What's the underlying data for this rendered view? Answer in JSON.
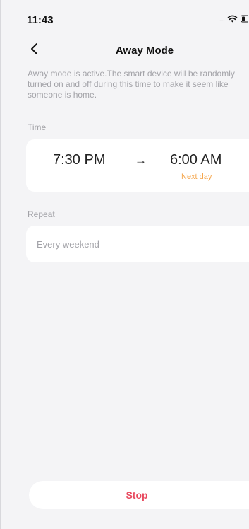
{
  "status_bar": {
    "time": "11:43",
    "signal_dots": "....",
    "wifi_icon": "wifi-icon",
    "battery_icon": "battery-icon"
  },
  "nav": {
    "back_icon": "chevron-left-icon",
    "title": "Away Mode"
  },
  "description": "Away mode is active.The smart device will be randomly turned on and off during this time to make it seem like someone is home.",
  "time_section": {
    "label": "Time",
    "start": "7:30 PM",
    "arrow": "→",
    "end": "6:00 AM",
    "end_note": "Next day",
    "end_note_color": "#f5a54a"
  },
  "repeat_section": {
    "label": "Repeat",
    "value": "Every weekend"
  },
  "actions": {
    "stop_label": "Stop",
    "stop_color": "#e84a5f"
  }
}
